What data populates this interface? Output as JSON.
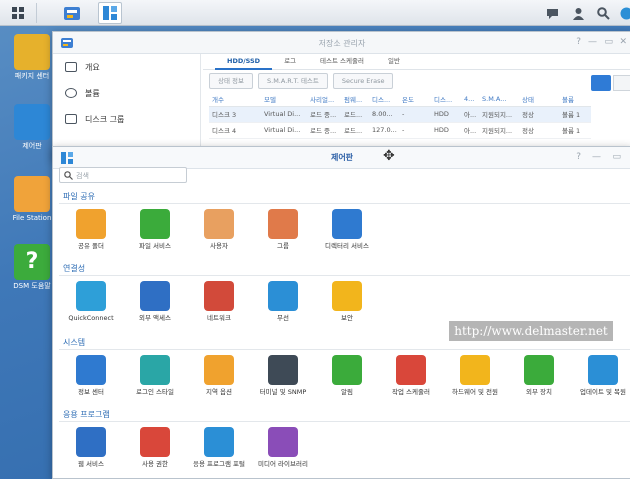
{
  "desktop": {
    "icons": [
      {
        "label": "패키지 센터",
        "name": "package-center-icon",
        "color": "#e6b12c"
      },
      {
        "label": "제어판",
        "name": "control-panel-icon",
        "color": "#2d87d6"
      },
      {
        "label": "File Station",
        "name": "file-station-icon",
        "color": "#f0a33a"
      },
      {
        "label": "DSM 도움말",
        "name": "dsm-help-icon",
        "color": "#3cab3c"
      }
    ]
  },
  "storage_manager": {
    "title": "저장소 관리자",
    "sidebar": [
      "개요",
      "볼륨",
      "디스크 그룹"
    ],
    "tabs": [
      "HDD/SSD",
      "로그",
      "테스트 스케줄러",
      "일반"
    ],
    "buttons": [
      "상태 정보",
      "S.M.A.R.T. 테스트",
      "Secure Erase"
    ],
    "columns": [
      "개수",
      "모델",
      "사리얼...",
      "펌웨...",
      "디스...",
      "온도",
      "디스...",
      "4...",
      "S.M.A...",
      "상태",
      "볼륨"
    ],
    "rows": [
      [
        "디스크 3",
        "Virtual Di...",
        "로드 중...",
        "로드...",
        "8.00...",
        "-",
        "HDD",
        "아...",
        "지원되지...",
        "정상",
        "볼륨 1"
      ],
      [
        "디스크 4",
        "Virtual Di...",
        "로드 중...",
        "로드...",
        "127.0...",
        "-",
        "HDD",
        "아...",
        "지원되지...",
        "정상",
        "볼륨 1"
      ]
    ]
  },
  "control_panel": {
    "title": "제어판",
    "search_placeholder": "검색",
    "sections": [
      {
        "title": "파일 공유",
        "items": [
          {
            "label": "공유 폴더",
            "icon": "shared-folder-icon",
            "color": "#f0a22e"
          },
          {
            "label": "파일 서비스",
            "icon": "file-services-icon",
            "color": "#3bab3b"
          },
          {
            "label": "사용자",
            "icon": "user-icon",
            "color": "#e8a060"
          },
          {
            "label": "그룹",
            "icon": "group-icon",
            "color": "#e07a4a"
          },
          {
            "label": "디렉터리 서비스",
            "icon": "directory-service-icon",
            "color": "#2f7ad0"
          }
        ]
      },
      {
        "title": "연결성",
        "items": [
          {
            "label": "QuickConnect",
            "icon": "quickconnect-icon",
            "color": "#2e9fd8"
          },
          {
            "label": "외부 액세스",
            "icon": "external-access-icon",
            "color": "#2f6fc4"
          },
          {
            "label": "네트워크",
            "icon": "network-icon",
            "color": "#d24a3a"
          },
          {
            "label": "무선",
            "icon": "wireless-icon",
            "color": "#2b8fd6"
          },
          {
            "label": "보안",
            "icon": "security-icon",
            "color": "#f2b51c"
          }
        ]
      },
      {
        "title": "시스템",
        "items": [
          {
            "label": "정보 센터",
            "icon": "info-center-icon",
            "color": "#2f7ad0"
          },
          {
            "label": "로그인 스타일",
            "icon": "login-style-icon",
            "color": "#2aa6a6"
          },
          {
            "label": "지역 옵션",
            "icon": "regional-options-icon",
            "color": "#f0a22e"
          },
          {
            "label": "터미널 및 SNMP",
            "icon": "terminal-icon",
            "color": "#3e4a56"
          },
          {
            "label": "알림",
            "icon": "notification-icon",
            "color": "#3bab3b"
          },
          {
            "label": "작업 스케줄러",
            "icon": "task-scheduler-icon",
            "color": "#d9473a"
          },
          {
            "label": "하드웨어 및 전원",
            "icon": "hardware-power-icon",
            "color": "#f2b51c"
          },
          {
            "label": "외부 장치",
            "icon": "external-devices-icon",
            "color": "#3bab3b"
          },
          {
            "label": "업데이트 및 복원",
            "icon": "update-restore-icon",
            "color": "#2b8fd6"
          }
        ]
      },
      {
        "title": "응용 프로그램",
        "items": [
          {
            "label": "웹 서비스",
            "icon": "web-services-icon",
            "color": "#2f6fc4"
          },
          {
            "label": "사용 권한",
            "icon": "privileges-icon",
            "color": "#d9473a"
          },
          {
            "label": "응용 프로그램 포털",
            "icon": "application-portal-icon",
            "color": "#2b8fd6"
          },
          {
            "label": "미디어 라이브러리",
            "icon": "media-library-icon",
            "color": "#8a4db8"
          }
        ]
      }
    ]
  },
  "watermark": "http://www.delmaster.net"
}
